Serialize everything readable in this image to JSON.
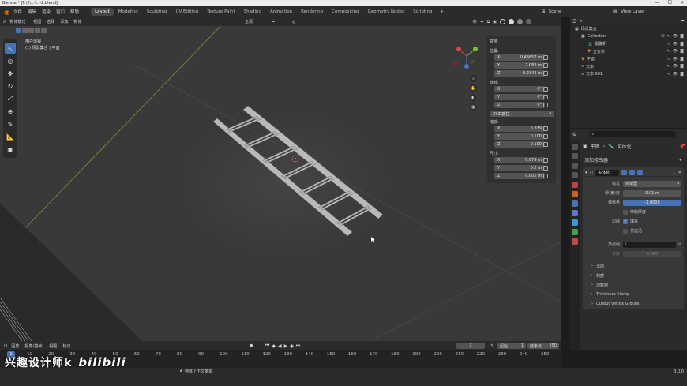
{
  "window": {
    "title": "Blender* [F:\\2\\...\\...-2.blend]",
    "min": "—",
    "max": "☐",
    "close": "✕"
  },
  "menu": [
    "文件",
    "编辑",
    "渲染",
    "窗口",
    "帮助"
  ],
  "workspaces": [
    "Layout",
    "Modeling",
    "Sculpting",
    "UV Editing",
    "Texture Paint",
    "Shading",
    "Animation",
    "Rendering",
    "Compositing",
    "Geometry Nodes",
    "Scripting"
  ],
  "scene": {
    "label": "Scene",
    "view_layer": "View Layer"
  },
  "viewport_header": {
    "mode": "物体模式",
    "menus": [
      "视图",
      "选择",
      "添加",
      "物体"
    ],
    "transform": "全局"
  },
  "viewport_info": {
    "line1": "用户透视",
    "line2": "(1) 场景集合 | 平面"
  },
  "transform_panel": {
    "tab": "变换",
    "location_label": "位置:",
    "location": [
      {
        "axis": "X",
        "value": "0.43657 m"
      },
      {
        "axis": "Y",
        "value": "2.083 m"
      },
      {
        "axis": "Z",
        "value": "-0.2344 m"
      }
    ],
    "rotation_label": "旋转:",
    "rotation": [
      {
        "axis": "X",
        "value": "0°"
      },
      {
        "axis": "Y",
        "value": "0°"
      },
      {
        "axis": "Z",
        "value": "0°"
      }
    ],
    "rotation_mode": "XYZ 欧拉",
    "scale_label": "缩放:",
    "scale": [
      {
        "axis": "X",
        "value": "0.339"
      },
      {
        "axis": "Y",
        "value": "0.100"
      },
      {
        "axis": "Z",
        "value": "0.100"
      }
    ],
    "dimensions_label": "尺寸:",
    "dimensions": [
      {
        "axis": "X",
        "value": "0.679 m"
      },
      {
        "axis": "Y",
        "value": "0.2 m"
      },
      {
        "axis": "Z",
        "value": "0.001 m"
      }
    ]
  },
  "outliner": {
    "title": "场景集合",
    "items": [
      {
        "name": "Collection",
        "depth": 1
      },
      {
        "name": "摄像机",
        "depth": 2
      },
      {
        "name": "立方体",
        "depth": 2
      },
      {
        "name": "平面",
        "depth": 1
      },
      {
        "name": "文本",
        "depth": 1
      },
      {
        "name": "文本.001",
        "depth": 1
      }
    ]
  },
  "properties": {
    "breadcrumb": [
      "平面",
      "实体化"
    ],
    "add_modifier": "添加修改器",
    "modifier_name": "实体化",
    "mode_label": "模式",
    "mode_value": "简单型",
    "thickness_label": "厚(宽)度",
    "thickness_value": "0.01 m",
    "offset_label": "偏移量",
    "offset_value": "-1.0000",
    "even_label": "均衡厚度",
    "rim_label": "边缘",
    "fill_label": "填充",
    "only_rim_label": "仅边沿",
    "vgroup_label": "顶点组",
    "factor_label": "系数",
    "factor_value": "0.000",
    "subpanels": [
      "法向",
      "材质",
      "边数据",
      "Thickness Clamp",
      "Output Vertex Groups"
    ]
  },
  "timeline": {
    "menus": [
      "回放",
      "抠像(插帧)",
      "视图",
      "标记"
    ],
    "current_frame": "1",
    "start_label": "起始",
    "start": "1",
    "end_label": "结束点",
    "end": "250",
    "ticks": [
      "0",
      "10",
      "20",
      "30",
      "40",
      "50",
      "60",
      "70",
      "80",
      "90",
      "100",
      "110",
      "120",
      "130",
      "140",
      "150",
      "160",
      "170",
      "180",
      "190",
      "200",
      "210",
      "220",
      "230",
      "240",
      "250"
    ]
  },
  "statusbar": {
    "hint": "物体上下文菜单",
    "version": "3.0.0"
  },
  "watermark": {
    "text": "兴趣设计师k",
    "logo": "bilibili"
  },
  "colors": {
    "accent": "#4772b3",
    "viewport": "#393939",
    "panel": "#303030"
  }
}
